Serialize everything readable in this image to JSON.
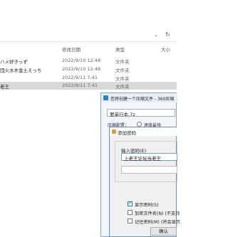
{
  "explorer": {
    "columns": {
      "modified": "修改日期",
      "type": "类型",
      "size": "大小"
    },
    "files": [
      {
        "name": "ハメ好きっず",
        "modified": "2022/9/10 12:48",
        "type": "文件夹",
        "selected": false
      },
      {
        "name": "団火水木金土えっち",
        "modified": "2022/9/10 12:48",
        "type": "文件夹",
        "selected": false
      },
      {
        "name": "",
        "modified": "2022/9/11 7:41",
        "type": "文件夹",
        "selected": false
      },
      {
        "name": "老王",
        "modified": "2022/9/11 7:41",
        "type": "文件夹",
        "selected": true
      }
    ]
  },
  "zip_dialog": {
    "title": "您将创建一个压缩文件 - 360压缩",
    "archive_name": "要单行本.7z",
    "mode_label": "压缩配置：",
    "option_label": "速度最快"
  },
  "password_dialog": {
    "title": "添加密码",
    "enter_label": "输入密码(E)",
    "password_value": "上老王论坛当老王",
    "options": [
      {
        "label": "显示密码(S)",
        "checked": true
      },
      {
        "label": "加密文件名(N) (不支持",
        "checked": false
      },
      {
        "label": "记住密码(M) (将会显示",
        "checked": false
      }
    ],
    "ok_label": "确认"
  }
}
